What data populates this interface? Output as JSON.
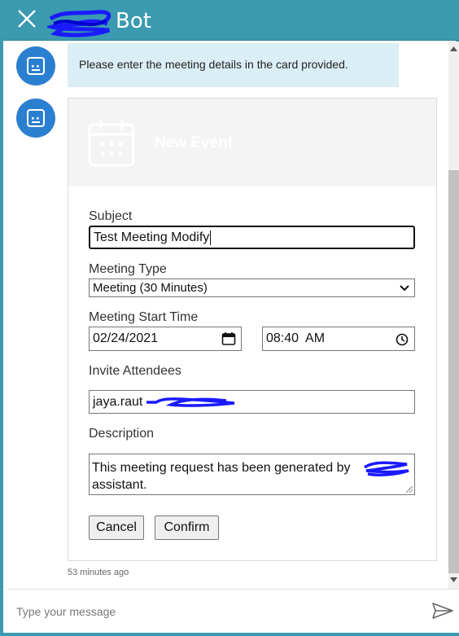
{
  "window": {
    "title": "Bot",
    "close_icon": "close-icon",
    "accent_color": "#3b9ab0"
  },
  "messages": [
    {
      "from": "bot",
      "avatar_icon": "bot-icon",
      "text": "Please enter the meeting details in the card provided."
    },
    {
      "from": "bot",
      "avatar_icon": "bot-icon",
      "card": {
        "hero_icon": "calendar-icon",
        "hero_title": "New Event",
        "subject_label": "Subject",
        "subject_value": "Test Meeting Modify",
        "meeting_type_label": "Meeting Type",
        "meeting_type_value": "Meeting (30 Minutes)",
        "start_time_label": "Meeting Start Time",
        "date_value": "02/24/2021",
        "time_value": "08:40  AM",
        "attendees_label": "Invite Attendees",
        "attendees_value": "jaya.raut",
        "description_label": "Description",
        "description_line1": "This meeting request has been generated by",
        "description_line2": "assistant.",
        "cancel_label": "Cancel",
        "confirm_label": "Confirm"
      }
    }
  ],
  "timestamp": "53 minutes ago",
  "composer": {
    "placeholder": "Type your message",
    "send_icon": "send-icon"
  }
}
